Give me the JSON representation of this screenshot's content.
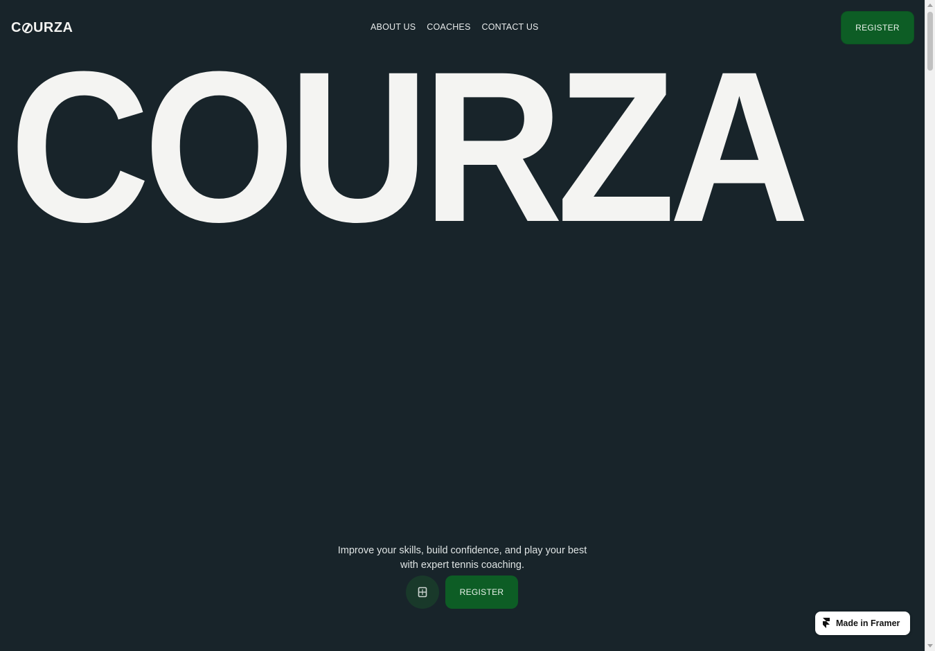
{
  "header": {
    "logo_prefix": "C",
    "logo_suffix": "URZA",
    "nav": [
      {
        "label": "ABOUT US"
      },
      {
        "label": "COACHES"
      },
      {
        "label": "CONTACT US"
      }
    ],
    "register_label": "REGISTER"
  },
  "hero": {
    "title": "COURZA",
    "tagline": "Improve your skills, build confidence, and play your best with expert tennis coaching.",
    "cta_icon": "tennis-court-icon",
    "register_label": "REGISTER"
  },
  "badge": {
    "icon": "framer-logo-icon",
    "label": "Made in Framer"
  },
  "colors": {
    "background": "#18242a",
    "accent_green": "#0d5d25",
    "text": "#f4f4f2"
  }
}
